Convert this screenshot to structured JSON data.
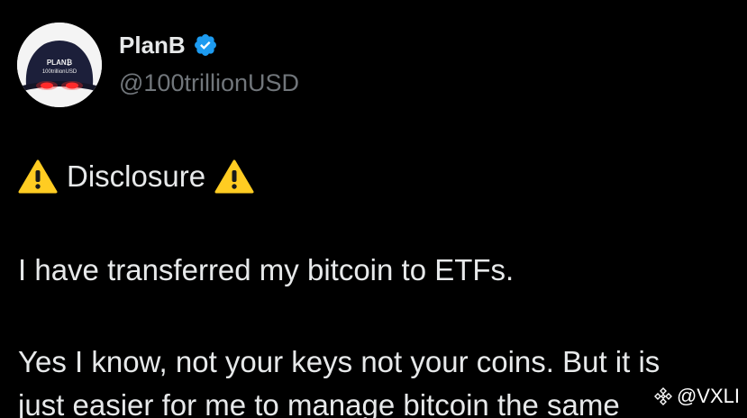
{
  "tweet": {
    "author": {
      "display_name": "PlanB",
      "handle": "@100trillionUSD",
      "verified": true,
      "avatar_text": [
        "PLAN₿",
        "100trillionUSD"
      ]
    },
    "disclosure": "Disclosure",
    "line1": "I have transferred my bitcoin to ETFs.",
    "line2": "Yes I know, not your keys not your coins. But it is",
    "line3": "just easier for me to manage bitcoin the same"
  },
  "watermark": {
    "icon": "binance-diamond-icon",
    "text": "@VXLI"
  },
  "colors": {
    "background": "#000000",
    "text": "#e7e9ea",
    "secondary": "#71767b",
    "verified": "#1d9bf0",
    "warning": "#ffcc22"
  }
}
